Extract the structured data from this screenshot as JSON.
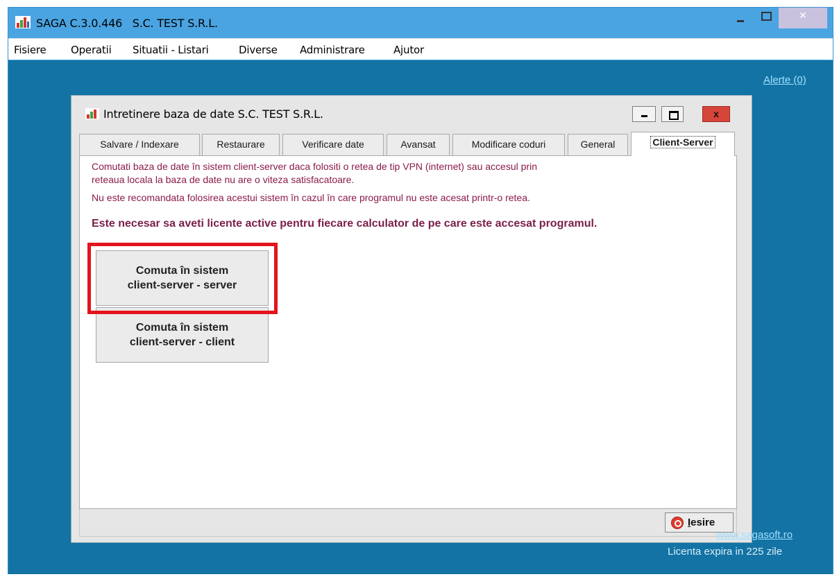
{
  "window": {
    "title": "SAGA C.3.0.446   S.C. TEST S.R.L.",
    "controls": {
      "minimize": "–",
      "maximize": "□",
      "close": "✕"
    }
  },
  "menu": [
    {
      "label": "Fisiere"
    },
    {
      "label": "Operatii"
    },
    {
      "label": "Situatii - Listari"
    },
    {
      "label": "Diverse"
    },
    {
      "label": "Administrare"
    },
    {
      "label": "Ajutor"
    }
  ],
  "desktop": {
    "alerts_link": "Alerte (0)",
    "website_link": "www.sagasoft.ro",
    "license_text": "Licenta expira in 225 zile"
  },
  "dialog": {
    "title": "Intretinere baza de date S.C. TEST S.R.L.",
    "close_glyph": "x",
    "tabs": [
      {
        "label": "Salvare / Indexare"
      },
      {
        "label": "Restaurare"
      },
      {
        "label": "Verificare date"
      },
      {
        "label": "Avansat"
      },
      {
        "label": "Modificare coduri"
      },
      {
        "label": "General"
      },
      {
        "label": "Client-Server"
      }
    ],
    "active_tab": "Client-Server",
    "info_lines": [
      "Comutati baza de date în sistem client-server daca folositi o retea de tip VPN (internet) sau accesul prin",
      "reteaua locala la baza de date nu are o viteza satisfacatoare.",
      "Nu este recomandata folosirea acestui sistem în cazul în care programul nu este acesat printr-o retea."
    ],
    "warning": "Este necesar sa aveti licente active pentru fiecare calculator de pe care este accesat programul.",
    "buttons": {
      "server": "Comuta în sistem\nclient-server - server",
      "client": "Comuta în sistem\nclient-server - client"
    },
    "exit_button": {
      "first_letter": "I",
      "rest": "esire"
    }
  },
  "colors": {
    "title_bar": "#4aa4e2",
    "desktop": "#1373a4",
    "info_text": "#8b1a4a",
    "highlight": "#e3141b"
  }
}
